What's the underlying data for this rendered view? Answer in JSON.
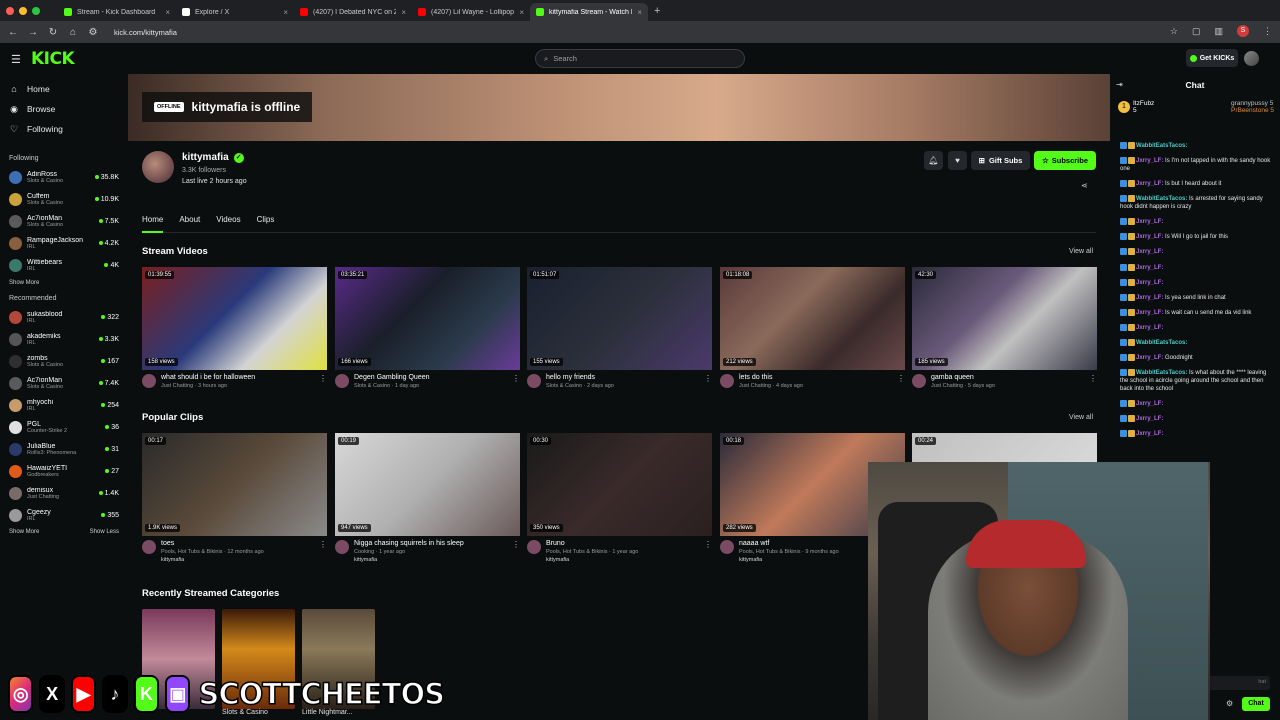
{
  "browser": {
    "tabs": [
      {
        "title": "Stream - Kick Dashboard",
        "fav_color": "#53fc18",
        "active": false
      },
      {
        "title": "Explore / X",
        "fav_color": "#ffffff",
        "active": false
      },
      {
        "title": "(4207) I Debated NYC on Zo...",
        "fav_color": "#ff0000",
        "active": false
      },
      {
        "title": "(4207) Lil Wayne - Lollipop (E...",
        "fav_color": "#ff0000",
        "active": false
      },
      {
        "title": "kittymafia Stream - Watch Li...",
        "fav_color": "#53fc18",
        "active": true
      }
    ],
    "new_tab": "+",
    "url": "kick.com/kittymafia",
    "profile_initial": "S"
  },
  "header": {
    "logo": "KICK",
    "search_placeholder": "Search",
    "get_kicks": "Get KICKs"
  },
  "sidebar": {
    "nav": [
      {
        "label": "Home",
        "icon": "⌂"
      },
      {
        "label": "Browse",
        "icon": "◉"
      },
      {
        "label": "Following",
        "icon": "♡"
      }
    ],
    "following_title": "Following",
    "following": [
      {
        "name": "AdinRoss",
        "category": "Slots & Casino",
        "count": "35.8K",
        "color": "#3d6fb5"
      },
      {
        "name": "Cuffem",
        "category": "Slots & Casino",
        "count": "10.9K",
        "color": "#c9a23a"
      },
      {
        "name": "Ac7ionMan",
        "category": "Slots & Casino",
        "count": "7.5K",
        "color": "#5a5a5a"
      },
      {
        "name": "RampageJackson",
        "category": "IRL",
        "count": "4.2K",
        "color": "#8a5f3c"
      },
      {
        "name": "Wittiebears",
        "category": "IRL",
        "count": "4K",
        "color": "#3b7a6a"
      }
    ],
    "show_more_1": "Show More",
    "recommended_title": "Recommended",
    "recommended": [
      {
        "name": "sukasblood",
        "category": "IRL",
        "count": "322",
        "color": "#b3473a"
      },
      {
        "name": "akademiks",
        "category": "IRL",
        "count": "3.3K",
        "color": "#555"
      },
      {
        "name": "zombs",
        "category": "Slots & Casino",
        "count": "167",
        "color": "#2f2f2f"
      },
      {
        "name": "Ac7ionMan",
        "category": "Slots & Casino",
        "count": "7.4K",
        "color": "#5a5a5a"
      },
      {
        "name": "mhyochi",
        "category": "IRL",
        "count": "254",
        "color": "#c99a6a"
      },
      {
        "name": "PGL",
        "category": "Counter-Strike 2",
        "count": "36",
        "color": "#e0e0e0"
      },
      {
        "name": "JuliaBlue",
        "category": "Rollis3: Phenomena",
        "count": "31",
        "color": "#2a3a6a"
      },
      {
        "name": "HawaiizYETI",
        "category": "Godbreakers",
        "count": "27",
        "color": "#e05a1a"
      },
      {
        "name": "demisux",
        "category": "Just Chatting",
        "count": "1.4K",
        "color": "#7b6a6a"
      },
      {
        "name": "Cgeezy",
        "category": "IRL",
        "count": "355",
        "color": "#9a9a9a"
      }
    ],
    "show_more_2": "Show More",
    "show_less": "Show Less"
  },
  "banner": {
    "offline_tag": "OFFLINE",
    "offline_title": "kittymafia is offline"
  },
  "channel": {
    "name": "kittymafia",
    "followers": "3.3K followers",
    "last_live": "Last live 2 hours ago",
    "gift_subs": "Gift Subs",
    "subscribe": "Subscribe",
    "tabs": [
      "Home",
      "About",
      "Videos",
      "Clips"
    ]
  },
  "stream_videos": {
    "title": "Stream Videos",
    "view_all": "View all",
    "items": [
      {
        "duration": "01:39:55",
        "views": "158 views",
        "title": "what should i be for halloween",
        "category": "Just Chatting",
        "age": "3 hours ago",
        "bg": "linear-gradient(135deg,#7a1f1f,#2a3a7a 45%,#d4d4d4 70%,#e0e040)"
      },
      {
        "duration": "03:35:21",
        "views": "166 views",
        "title": "Degen Gambling Queen",
        "category": "Slots & Casino",
        "age": "1 day ago",
        "bg": "linear-gradient(135deg,#5a2a8a,#1a1f2a 40%,#2a3a4a 70%,#6a3a9a)"
      },
      {
        "duration": "01:51:07",
        "views": "155 views",
        "title": "hello my friends",
        "category": "Slots & Casino",
        "age": "2 days ago",
        "bg": "linear-gradient(135deg,#1a2030,#2a2f3a 50%,#4a3a6a)"
      },
      {
        "duration": "01:18:08",
        "views": "212 views",
        "title": "lets do this",
        "category": "Just Chatting",
        "age": "4 days ago",
        "bg": "linear-gradient(135deg,#5a3a3a,#8a6a5a 40%,#3a2a2a 70%,#6a4a4a)"
      },
      {
        "duration": "42:30",
        "views": "185 views",
        "title": "gamba queen",
        "category": "Just Chatting",
        "age": "5 days ago",
        "bg": "linear-gradient(135deg,#2a2a3a,#6a5a7a 40%,#c0c0c0 60%,#3a3a4a)"
      }
    ]
  },
  "popular_clips": {
    "title": "Popular Clips",
    "view_all": "View all",
    "items": [
      {
        "duration": "00:17",
        "views": "1.9K views",
        "title": "toes",
        "category": "Pools, Hot Tubs & Bikinis",
        "age": "12 months ago",
        "channel": "kittymafia",
        "bg": "linear-gradient(135deg,#2a2a2a,#5a4a3a 50%,#8a8a8a)"
      },
      {
        "duration": "00:19",
        "views": "947 views",
        "title": "Nigga chasing squirrels in his sleep",
        "category": "Cooking",
        "age": "1 year ago",
        "channel": "kittymafia",
        "bg": "linear-gradient(135deg,#d8d8d8,#b0b0b0 50%,#6a5a5a)"
      },
      {
        "duration": "00:30",
        "views": "350 views",
        "title": "Bruno",
        "category": "Pools, Hot Tubs & Bikinis",
        "age": "1 year ago",
        "channel": "kittymafia",
        "bg": "linear-gradient(135deg,#1a1a1a,#3a2a2a 50%,#2a2020)"
      },
      {
        "duration": "00:18",
        "views": "282 views",
        "title": "naaaa wtf",
        "category": "Pools, Hot Tubs & Bikinis",
        "age": "9 months ago",
        "channel": "kittymafia",
        "bg": "linear-gradient(135deg,#2a2a3a,#c07a5a 50%,#3a3a4a)"
      },
      {
        "duration": "00:24",
        "views": "",
        "title": "",
        "category": "",
        "age": "",
        "channel": "",
        "bg": "linear-gradient(135deg,#c0c0c0,#e0e0e0)"
      }
    ]
  },
  "categories": {
    "title": "Recently Streamed Categories",
    "items": [
      {
        "label": "",
        "bg": "linear-gradient(180deg,#7a3a5a,#c28a9a 50%,#3a2a3a)"
      },
      {
        "label": "Slots & Casino",
        "bg": "linear-gradient(180deg,#3a1a0a,#d48a1a 40%,#6a2a0a)"
      },
      {
        "label": "Little Nightmar...",
        "bg": "linear-gradient(180deg,#5a4a3a,#8a7a5a 40%,#2a2018)"
      }
    ]
  },
  "chat": {
    "title": "Chat",
    "pinned": [
      {
        "name": "ItzFubz",
        "count": "5"
      },
      {
        "name": "grannypussy",
        "count": "5"
      },
      {
        "name": "PrBeenstone",
        "count": "5"
      }
    ],
    "messages": [
      {
        "user": "WabbitEatsTacos:",
        "text": "",
        "color": "#4ec9c9"
      },
      {
        "user": "Jxrry_LF:",
        "text": "Is I'm not tapped in with the sandy hook one",
        "color": "#b06be0"
      },
      {
        "user": "Jxrry_LF:",
        "text": "Is but I heard about it",
        "color": "#b06be0"
      },
      {
        "user": "WabbitEatsTacos:",
        "text": "Is arrested for saying sandy hook didnt happen is crazy",
        "color": "#4ec9c9"
      },
      {
        "user": "Jxrry_LF:",
        "text": "",
        "color": "#b06be0"
      },
      {
        "user": "Jxrry_LF:",
        "text": "Is Will I go to jail for this",
        "color": "#b06be0"
      },
      {
        "user": "Jxrry_LF:",
        "text": "",
        "color": "#b06be0"
      },
      {
        "user": "Jxrry_LF:",
        "text": "",
        "color": "#b06be0"
      },
      {
        "user": "Jxrry_LF:",
        "text": "",
        "color": "#b06be0"
      },
      {
        "user": "Jxrry_LF:",
        "text": "Is yea send link in chat",
        "color": "#b06be0"
      },
      {
        "user": "Jxrry_LF:",
        "text": "Is wait can u send me da vid link",
        "color": "#b06be0"
      },
      {
        "user": "Jxrry_LF:",
        "text": "",
        "color": "#b06be0"
      },
      {
        "user": "WabbitEatsTacos:",
        "text": "",
        "color": "#4ec9c9"
      },
      {
        "user": "Jxrry_LF:",
        "text": "Goodnight",
        "color": "#b06be0"
      },
      {
        "user": "WabbitEatsTacos:",
        "text": "Is what about the **** leaving the school in acircle going around the school and then back into the school",
        "color": "#4ec9c9"
      },
      {
        "user": "Jxrry_LF:",
        "text": "",
        "color": "#b06be0"
      },
      {
        "user": "Jxrry_LF:",
        "text": "",
        "color": "#b06be0"
      },
      {
        "user": "Jxrry_LF:",
        "text": "",
        "color": "#b06be0"
      }
    ],
    "input_placeholder": "hat",
    "send": "Chat"
  },
  "overlay": {
    "brand": "SCOTTCHEETOS",
    "socials": [
      {
        "name": "instagram-icon",
        "glyph": "◎",
        "bg": "linear-gradient(135deg,#f58529,#dd2a7b 50%,#8134af)"
      },
      {
        "name": "x-icon",
        "glyph": "X",
        "bg": "#000000"
      },
      {
        "name": "youtube-icon",
        "glyph": "▶",
        "bg": "#ff0000"
      },
      {
        "name": "tiktok-icon",
        "glyph": "♪",
        "bg": "#000000"
      },
      {
        "name": "kick-icon",
        "glyph": "K",
        "bg": "#53fc18"
      },
      {
        "name": "twitch-icon",
        "glyph": "▣",
        "bg": "#9146ff"
      }
    ]
  }
}
